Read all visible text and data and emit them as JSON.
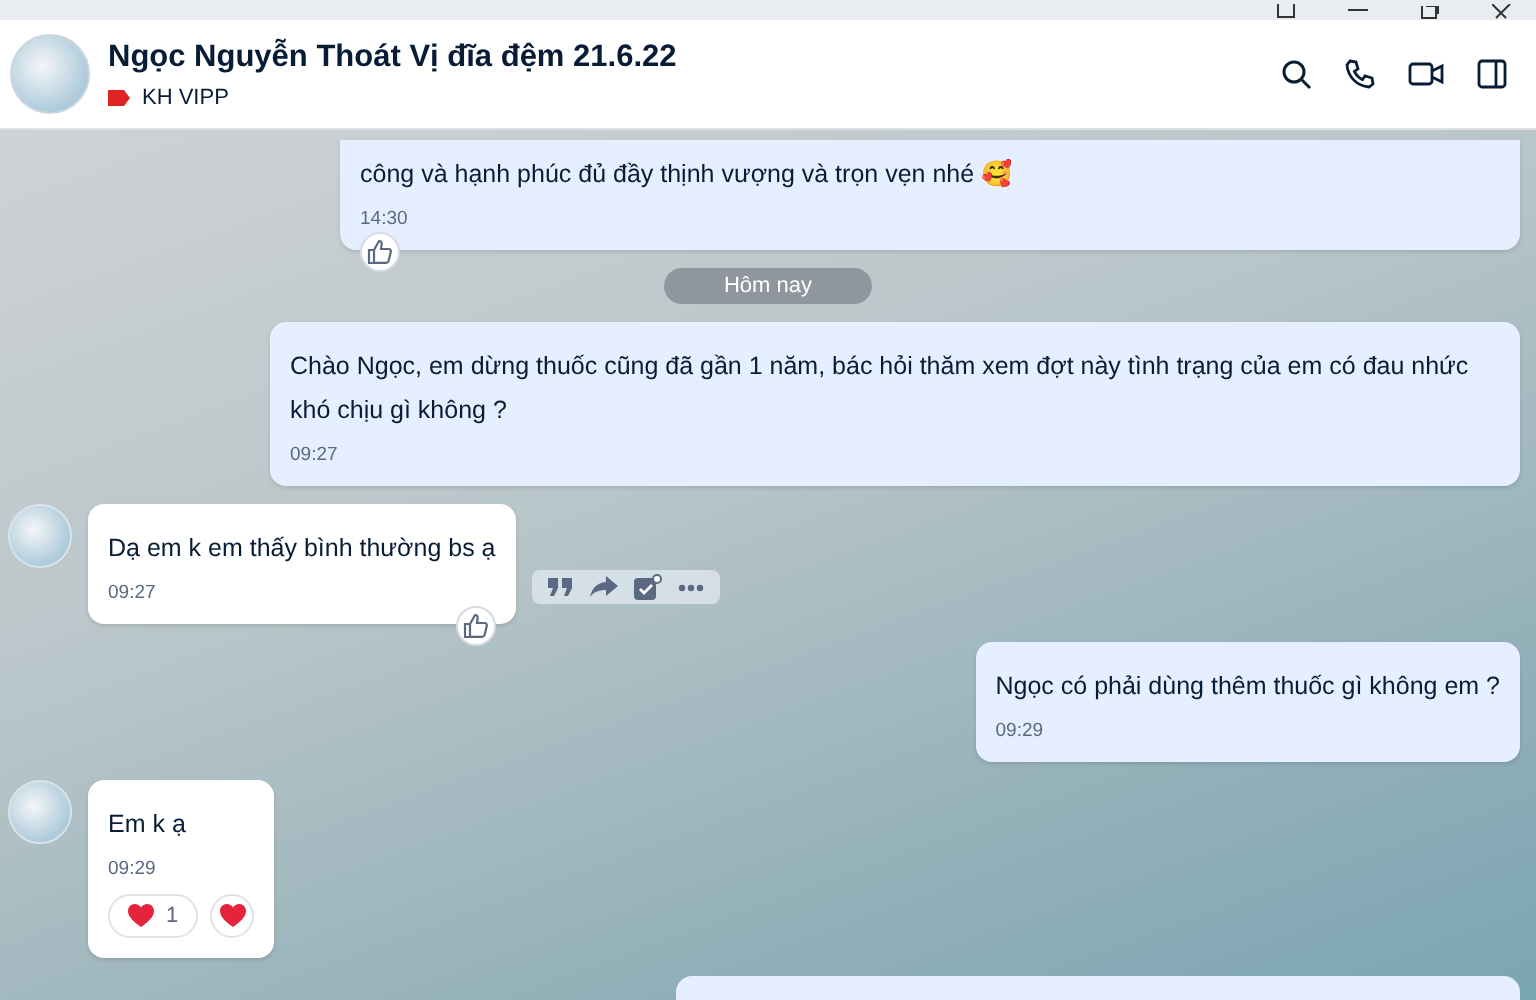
{
  "header": {
    "name": "Ngọc Nguyễn Thoát Vị đĩa đệm 21.6.22",
    "tag": {
      "label": "KH VIPP",
      "color": "#e02424"
    }
  },
  "messages": [
    {
      "kind": "outgoing",
      "text": "công và hạnh phúc đủ đầy thịnh vượng và trọn vẹn nhé 🥰",
      "time": "14:30",
      "like_button": true,
      "actions_visible": false
    },
    {
      "kind": "date",
      "text": "Hôm nay"
    },
    {
      "kind": "outgoing",
      "text": "Chào Ngọc, em dừng thuốc cũng đã gần 1 năm, bác hỏi thăm xem đợt này tình trạng của em có đau nhức khó chịu gì không ?",
      "time": "09:27",
      "like_button": false,
      "actions_visible": false
    },
    {
      "kind": "incoming",
      "text": "Dạ em k em thấy bình thường bs ạ",
      "time": "09:27",
      "like_button": true,
      "actions_visible": true
    },
    {
      "kind": "outgoing",
      "text": "Ngọc có phải dùng thêm thuốc gì không em ?",
      "time": "09:29",
      "like_button": false,
      "actions_visible": false
    },
    {
      "kind": "incoming",
      "text": "Em k ạ",
      "time": "09:29",
      "like_button": false,
      "actions_visible": false,
      "reactions": [
        {
          "kind": "heart",
          "count": "1"
        }
      ],
      "react_button": true
    },
    {
      "kind": "outgoing_cut"
    }
  ]
}
